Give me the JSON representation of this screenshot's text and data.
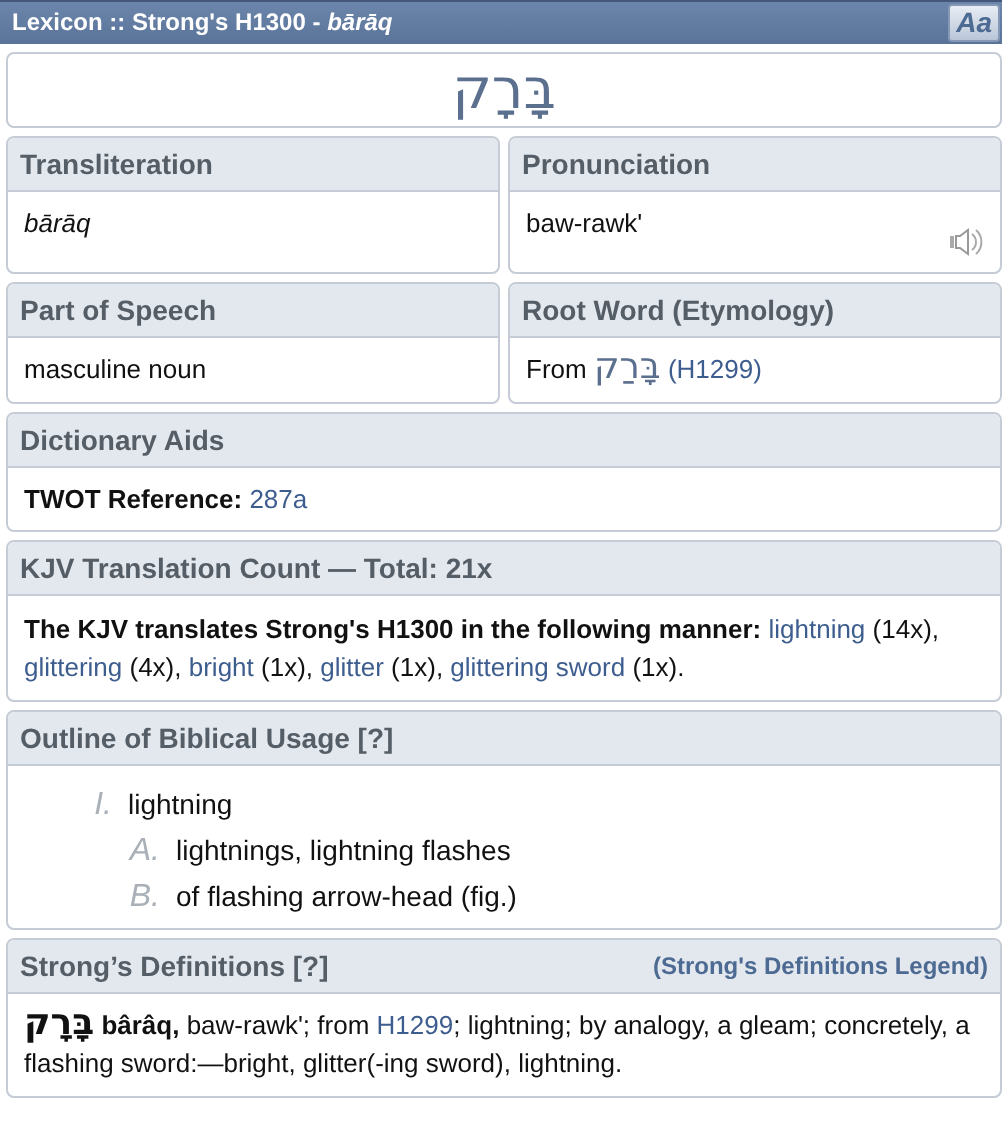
{
  "title_bar": {
    "title": "Lexicon :: Strong's H1300 - *bārāq*",
    "font_button": "Aa"
  },
  "headword": "בָּרָק",
  "transliteration": {
    "heading": "Transliteration",
    "value": "bārāq"
  },
  "pronunciation": {
    "heading": "Pronunciation",
    "value": "baw-rawk'"
  },
  "part_of_speech": {
    "heading": "Part of Speech",
    "value": "masculine noun"
  },
  "root_word": {
    "heading": "Root Word (Etymology)",
    "prefix": "From",
    "hebrew": "בָּרַק",
    "link": "(H1299)"
  },
  "dictionary_aids": {
    "heading": "Dictionary Aids",
    "label": "TWOT Reference:",
    "link": "287a"
  },
  "kjv": {
    "heading": "KJV Translation Count — Total: 21x",
    "intro": "The KJV translates Strong's H1300 in the following manner:",
    "entries": [
      {
        "word": "lightning",
        "after": " (14x), "
      },
      {
        "word": "glittering",
        "after": " (4x), "
      },
      {
        "word": "bright",
        "after": " (1x), "
      },
      {
        "word": "glitter",
        "after": " (1x), "
      },
      {
        "word": "glittering sword",
        "after": " (1x)."
      }
    ]
  },
  "outline": {
    "heading": "Outline of Biblical Usage [?]",
    "items": [
      {
        "marker": "I.",
        "text": "lightning",
        "children": [
          {
            "marker": "A.",
            "text": "lightnings, lightning flashes"
          },
          {
            "marker": "B.",
            "text": "of flashing arrow-head (fig.)"
          }
        ]
      }
    ]
  },
  "strongs": {
    "heading": "Strong’s Definitions [?]",
    "legend_link": "(Strong's Definitions Legend)",
    "hebrew": "בָּרָק",
    "lemma": "bârâq,",
    "before_link": " baw-rawk'; from ",
    "link": "H1299",
    "after_link": "; lightning; by analogy, a gleam; concretely, a flashing sword:—bright, glitter(-ing sword), lightning."
  }
}
